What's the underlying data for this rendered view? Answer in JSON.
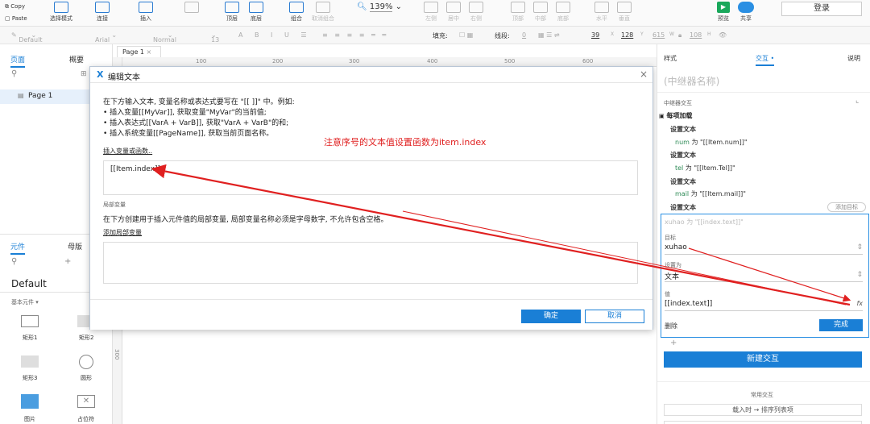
{
  "toolbar": {
    "copy": "Copy",
    "paste": "Paste",
    "select_mode": "选择模式",
    "connect": "连接",
    "insert": "插入",
    "top": "顶层",
    "bottom": "底层",
    "group": "组合",
    "ungroup": "取消组合",
    "zoom": "139%",
    "align_left": "左侧",
    "align_center": "居中",
    "align_right": "右侧",
    "align_top": "顶部",
    "align_middle": "中部",
    "align_bottom": "底部",
    "horizontal": "水平",
    "vertical": "垂直",
    "preview": "预览",
    "share": "共享",
    "login": "登录"
  },
  "format_bar": {
    "style": "Default",
    "font": "Arial",
    "weight": "Normal",
    "size": "13",
    "fill": "填充:",
    "line": "线段:",
    "line_value": "0",
    "x": "39",
    "x_label": "X",
    "y": "128",
    "y_label": "Y",
    "w": "615",
    "w_label": "W",
    "h": "108",
    "h_label": "H"
  },
  "left_panel": {
    "tab_pages": "页面",
    "tab_outline": "概要",
    "page_item": "Page 1",
    "tab_widgets": "元件",
    "tab_masters": "母版",
    "library": "Default",
    "group_label": "基本元件 ▾",
    "widgets": [
      "矩形1",
      "矩形2",
      "矩形3",
      "圆形",
      "图片",
      "占位符"
    ]
  },
  "canvas": {
    "tab": "Page 1",
    "ruler_h": [
      "100",
      "200",
      "300",
      "400",
      "500",
      "600"
    ],
    "ruler_v": "300"
  },
  "dialog": {
    "title": "编辑文本",
    "intro": "在下方输入文本, 变量名称或表达式要写在 \"[[ ]]\" 中。例如:",
    "bullet1": "• 插入变量[[MyVar]], 获取变量\"MyVar\"的当前值;",
    "bullet2": "• 插入表达式[[VarA + VarB]], 获取\"VarA + VarB\"的和;",
    "bullet3": "• 插入系统变量[[PageName]], 获取当前页面名称。",
    "insert_link": "插入变量或函数..",
    "textarea_value": "[[Item.index]]",
    "annotation": "注意序号的文本值设置函数为item.index",
    "local_vars_title": "局部变量",
    "local_vars_desc": "在下方创建用于插入元件值的局部变量, 局部变量名称必须是字母数字, 不允许包含空格。",
    "add_local_link": "添加局部变量",
    "ok": "确定",
    "cancel": "取消"
  },
  "right_panel": {
    "tab_style": "样式",
    "tab_interaction": "交互",
    "tab_notes": "说明",
    "name_placeholder": "(中继器名称)",
    "section": "中继器交互",
    "event": "每项加载",
    "actions": [
      {
        "title": "设置文本",
        "target": "num",
        "mid": "为",
        "value": "\"[[Item.num]]\""
      },
      {
        "title": "设置文本",
        "target": "tel",
        "mid": "为",
        "value": "\"[[Item.Tel]]\""
      },
      {
        "title": "设置文本",
        "target": "mail",
        "mid": "为",
        "value": "\"[[Item.mail]]\""
      }
    ],
    "action4_title": "设置文本",
    "add_target": "添加目标",
    "editing_summary": "xuhao 为 \"[[index.text]]\"",
    "target_label": "目标",
    "target_value": "xuhao",
    "set_as_label": "设置为",
    "set_as_value": "文本",
    "value_label": "值",
    "value_value": "[[index.text]]",
    "fx": "fx",
    "delete": "删除",
    "done": "完成",
    "plus": "+",
    "new_interaction": "新建交互",
    "common_title": "常用交互",
    "common1": "载入时 → 排序列表项"
  },
  "colors": {
    "accent": "#1a7fd6",
    "annotation": "#e02020"
  }
}
